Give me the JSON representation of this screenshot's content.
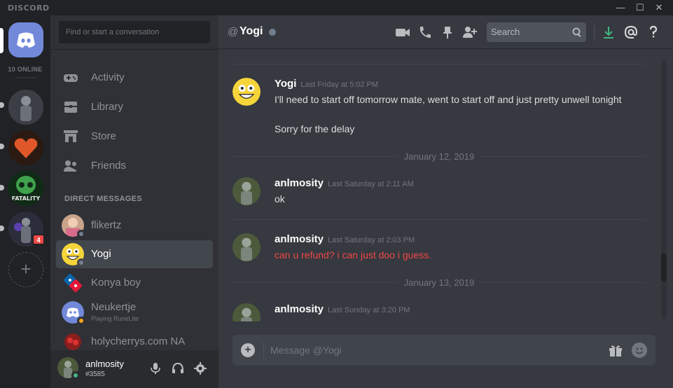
{
  "window": {
    "brand": "DISCORD",
    "controls": {
      "minimize": "—",
      "maximize": "☐",
      "close": "✕"
    }
  },
  "rail": {
    "online_label": "10 ONLINE",
    "servers": [
      {
        "name": "server-1-avatar",
        "color": "#4a4d52"
      },
      {
        "name": "server-2-heart",
        "color": "#e0572a"
      },
      {
        "name": "server-3-fatality",
        "color": "#1f5a2e",
        "caption": "FATALITY"
      },
      {
        "name": "server-4-avatar",
        "color": "#3d3f52",
        "badge": "4"
      }
    ],
    "add_server": "+"
  },
  "dm_panel": {
    "search_placeholder": "Find or start a conversation",
    "nav": [
      {
        "label": "Activity",
        "icon": "gamepad-icon"
      },
      {
        "label": "Library",
        "icon": "library-icon"
      },
      {
        "label": "Store",
        "icon": "store-icon"
      },
      {
        "label": "Friends",
        "icon": "friends-icon"
      }
    ],
    "direct_messages_label": "DIRECT MESSAGES",
    "dms": [
      {
        "name": "flikertz",
        "status": "#747f8d"
      },
      {
        "name": "Yogi",
        "status": "#747f8d",
        "active": true
      },
      {
        "name": "Konya boy",
        "status": ""
      },
      {
        "name": "Neukertje",
        "status": "#faa61a",
        "activity": "Playing RuneLite"
      },
      {
        "name": "holycherrys.com NA",
        "status": ""
      }
    ],
    "user": {
      "name": "anlmosity",
      "tag": "#3585",
      "status": "#43b581"
    }
  },
  "chat": {
    "header": {
      "at": "@",
      "title": "Yogi",
      "search_placeholder": "Search"
    },
    "messages": [
      {
        "author": "Yogi",
        "timestamp": "Last Friday at 5:02 PM",
        "lines": [
          "I'll need to start off tomorrow mate, went to start off and just pretty unwell tonight",
          "Sorry for the delay"
        ]
      },
      {
        "divider": "January 12, 2019"
      },
      {
        "author": "anlmosity",
        "timestamp": "Last Saturday at 2:11 AM",
        "lines": [
          "ok"
        ]
      },
      {
        "author": "anlmosity",
        "timestamp": "Last Saturday at 2:03 PM",
        "lines": [
          "can u refund? i can just doo i guess."
        ],
        "highlight": "#f04747"
      },
      {
        "divider": "January 13, 2019"
      },
      {
        "author": "anlmosity",
        "timestamp": "Last Sunday at 3:20 PM",
        "lines": []
      }
    ],
    "composer_placeholder": "Message @Yogi"
  },
  "colors": {
    "accent": "#7289da",
    "download": "#43b581",
    "mention_red": "#f04747"
  }
}
